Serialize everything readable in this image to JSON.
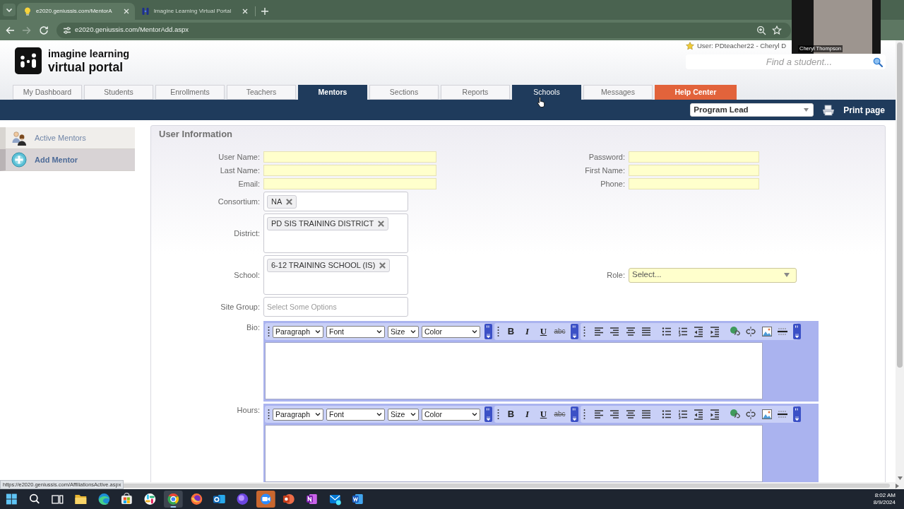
{
  "browser": {
    "tabs": [
      {
        "title": "e2020.geniussis.com/MentorA",
        "selected": true
      },
      {
        "title": "Imagine Learning Virtual Portal",
        "selected": false
      }
    ],
    "can_go_forward": false,
    "address": "e2020.geniussis.com/MentorAdd.aspx"
  },
  "video_call": {
    "name": "Cheryl Thompson"
  },
  "header": {
    "logo": [
      "imagine learning",
      "virtual portal"
    ],
    "user": "User: PDteacher22 - Cheryl D",
    "search": {
      "placeholder": "Find a student..."
    }
  },
  "nav_tabs": [
    {
      "label": "My Dashboard",
      "kind": "tab",
      "selected": false,
      "hovered": false
    },
    {
      "label": "Students",
      "kind": "tab",
      "selected": false,
      "hovered": false
    },
    {
      "label": "Enrollments",
      "kind": "tab",
      "selected": false,
      "hovered": false
    },
    {
      "label": "Teachers",
      "kind": "tab",
      "selected": false,
      "hovered": false
    },
    {
      "label": "Mentors",
      "kind": "tab",
      "selected": true,
      "hovered": false
    },
    {
      "label": "Sections",
      "kind": "tab",
      "selected": false,
      "hovered": false
    },
    {
      "label": "Reports",
      "kind": "tab",
      "selected": false,
      "hovered": false
    },
    {
      "label": "Schools",
      "kind": "tab",
      "selected": false,
      "hovered": true
    },
    {
      "label": "Messages",
      "kind": "tab",
      "selected": false,
      "hovered": false
    },
    {
      "label": "Help Center",
      "kind": "help",
      "selected": false,
      "hovered": false
    }
  ],
  "toolbar": {
    "role": "Program Lead",
    "print": "Print page"
  },
  "sidebar": {
    "items": [
      {
        "label": "Active Mentors",
        "selected": false
      },
      {
        "label": "Add Mentor",
        "selected": true
      }
    ]
  },
  "form": {
    "title": "User Information",
    "left_fields": [
      {
        "label": "User Name:"
      },
      {
        "label": "Last Name:"
      },
      {
        "label": "Email:"
      }
    ],
    "right_fields": [
      {
        "label": "Password:"
      },
      {
        "label": "First Name:"
      },
      {
        "label": "Phone:"
      }
    ],
    "multi_selects": [
      {
        "label": "Consortium:",
        "kind": "compact",
        "chips": [
          "NA"
        ]
      },
      {
        "label": "District:",
        "kind": "tall",
        "chips": [
          "PD SIS TRAINING DISTRICT"
        ]
      },
      {
        "label": "School:",
        "kind": "tall",
        "chips": [
          "6-12 TRAINING SCHOOL (IS)"
        ]
      }
    ],
    "role": {
      "label": "Role:",
      "value": "Select..."
    },
    "site_group": {
      "label": "Site Group:",
      "placeholder": "Select Some Options"
    },
    "editors": [
      {
        "label": "Bio:",
        "dropdowns": [
          "Paragraph",
          "Font",
          "Size",
          "Color"
        ],
        "format_buttons": [
          "B",
          "I",
          "U",
          "abc"
        ]
      },
      {
        "label": "Hours:",
        "dropdowns": [
          "Paragraph",
          "Font",
          "Size",
          "Color"
        ],
        "format_buttons": [
          "B",
          "I",
          "U",
          "abc"
        ]
      }
    ]
  },
  "status_url": "https://e2020.geniussis.com/AffiliationsActive.aspx",
  "taskbar": {
    "apps": [
      {
        "kind": "start",
        "selected": false,
        "alert": false
      },
      {
        "kind": "search",
        "selected": false,
        "alert": false
      },
      {
        "kind": "taskview",
        "selected": false,
        "alert": false
      },
      {
        "kind": "folder",
        "selected": false,
        "alert": false
      },
      {
        "kind": "wave",
        "selected": false,
        "alert": false
      },
      {
        "kind": "bag",
        "selected": false,
        "alert": false
      },
      {
        "kind": "pinwheel",
        "selected": false,
        "alert": false
      },
      {
        "kind": "ring",
        "selected": true,
        "alert": false
      },
      {
        "kind": "fox",
        "selected": false,
        "alert": false
      },
      {
        "kind": "mail",
        "selected": false,
        "alert": false
      },
      {
        "kind": "orb",
        "selected": false,
        "alert": false
      },
      {
        "kind": "camera",
        "selected": false,
        "alert": true
      },
      {
        "kind": "slides",
        "selected": false,
        "alert": false
      },
      {
        "kind": "notebook",
        "selected": false,
        "alert": false
      },
      {
        "kind": "mailnew",
        "selected": false,
        "alert": false
      },
      {
        "kind": "document",
        "selected": false,
        "alert": false
      }
    ],
    "time": "8:02 AM",
    "date": "8/9/2024"
  }
}
